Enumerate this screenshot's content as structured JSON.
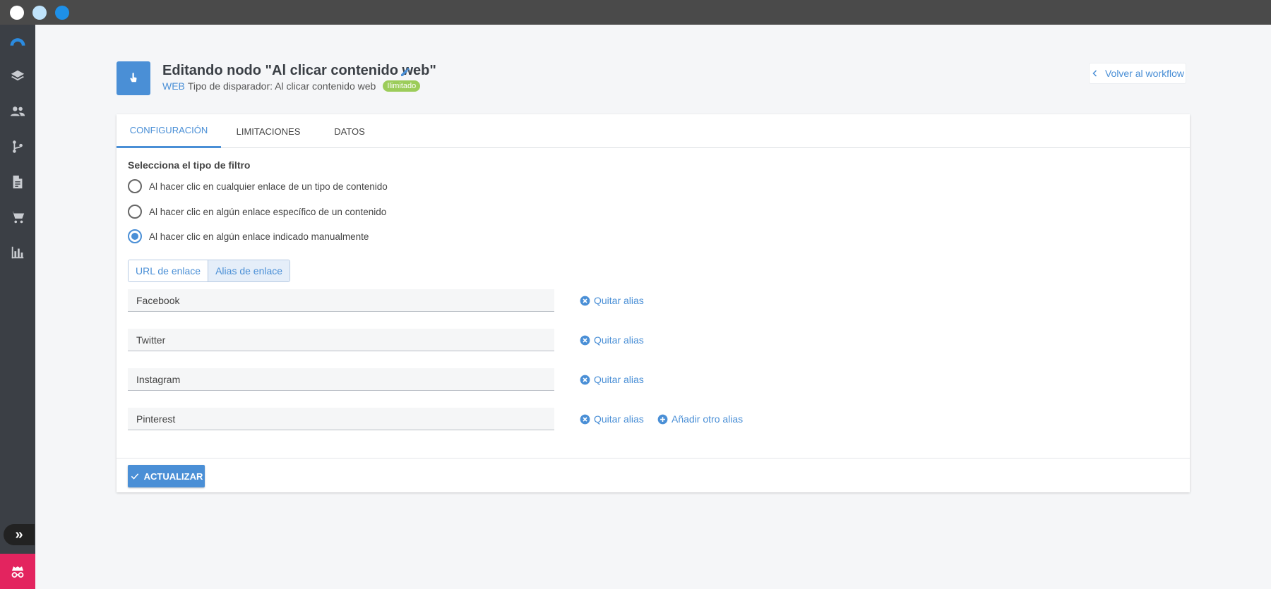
{
  "window": {
    "controls": [
      {
        "name": "close",
        "color": "#ffffff"
      },
      {
        "name": "minimize",
        "color": "#bfe3fb"
      },
      {
        "name": "maximize",
        "color": "#1e90e8"
      }
    ]
  },
  "sidebar": {
    "icons": [
      "logo-icon",
      "layers-icon",
      "users-icon",
      "workflow-icon",
      "document-icon",
      "cart-icon",
      "bar-chart-icon"
    ],
    "expand_icon": "double-chevron-right-icon",
    "bottom_icon": "incognito-icon"
  },
  "header": {
    "title": "Editando nodo \"Al clicar contenido web\"",
    "channel": "WEB",
    "trigger_text": "Tipo de disparador: Al clicar contenido web",
    "badge": "Ilimitado",
    "back_label": "Volver al workflow"
  },
  "tabs": [
    {
      "label": "Configuración",
      "active": true
    },
    {
      "label": "Limitaciones",
      "active": false
    },
    {
      "label": "Datos",
      "active": false
    }
  ],
  "filter": {
    "label": "Selecciona el tipo de filtro",
    "options": [
      {
        "label": "Al hacer clic en cualquier enlace de un tipo de contenido",
        "checked": false
      },
      {
        "label": "Al hacer clic en algún enlace específico de un contenido",
        "checked": false
      },
      {
        "label": "Al hacer clic en algún enlace indicado manualmente",
        "checked": true
      }
    ]
  },
  "link_mode": {
    "options": [
      "URL de enlace",
      "Alias de enlace"
    ],
    "selected": "Alias de enlace"
  },
  "aliases": [
    {
      "value": "Facebook",
      "remove_label": "Quitar alias"
    },
    {
      "value": "Twitter",
      "remove_label": "Quitar alias"
    },
    {
      "value": "Instagram",
      "remove_label": "Quitar alias"
    },
    {
      "value": "Pinterest",
      "remove_label": "Quitar alias"
    }
  ],
  "add_alias_label": "Añadir otro alias",
  "update_label": "ACTUALIZAR",
  "colors": {
    "accent": "#4a8fd6",
    "badge": "#9ccc5a",
    "sidebar": "#3b3f45",
    "bottom_button": "#e3245f"
  }
}
